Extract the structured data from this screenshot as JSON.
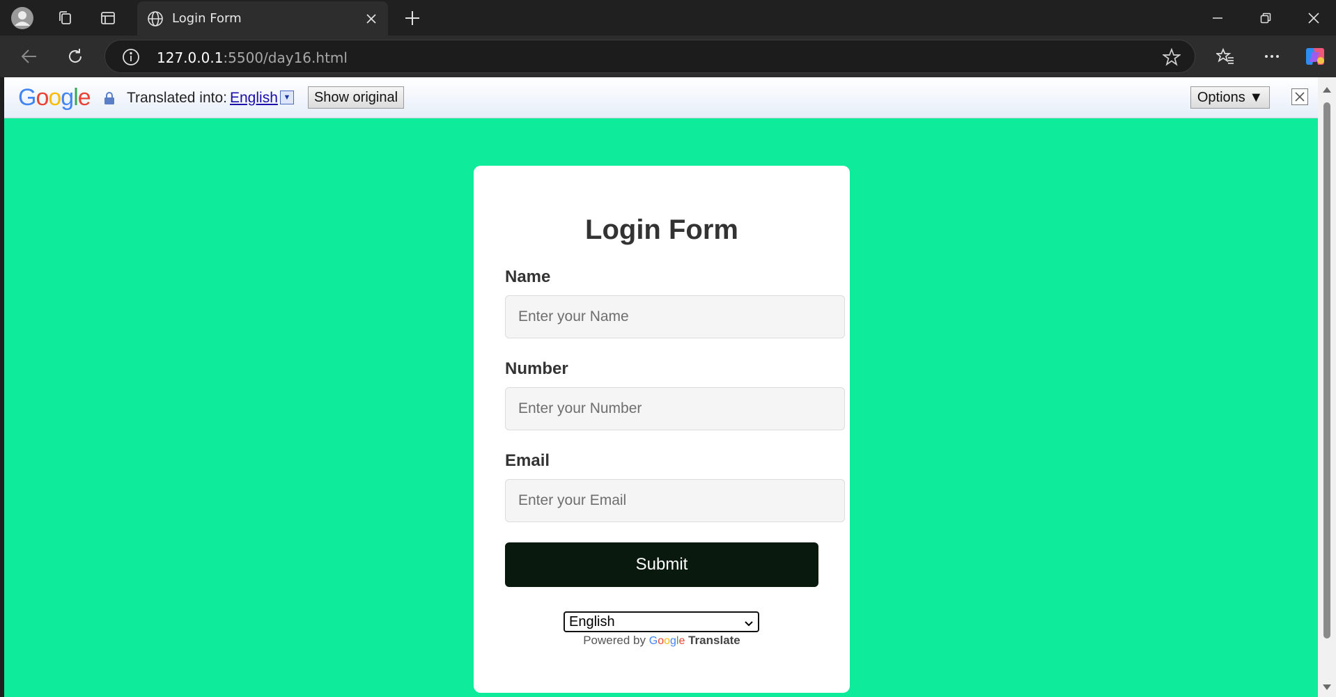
{
  "browser": {
    "tab_title": "Login Form",
    "url_host": "127.0.0.1",
    "url_path": ":5500/day16.html"
  },
  "translate_bar": {
    "logo": "Google",
    "translated_label": "Translated into:",
    "language": "English",
    "show_original_label": "Show original",
    "options_label": "Options ▼"
  },
  "form": {
    "title": "Login Form",
    "fields": [
      {
        "label": "Name",
        "placeholder": "Enter your Name"
      },
      {
        "label": "Number",
        "placeholder": "Enter your Number"
      },
      {
        "label": "Email",
        "placeholder": "Enter your Email"
      }
    ],
    "submit_label": "Submit",
    "language_select_value": "English",
    "powered_by": "Powered by",
    "google_text": "Google",
    "translate_text": "Translate"
  },
  "colors": {
    "page_background": "#0deb9b",
    "submit_background": "#09190d",
    "card_background": "#ffffff"
  }
}
